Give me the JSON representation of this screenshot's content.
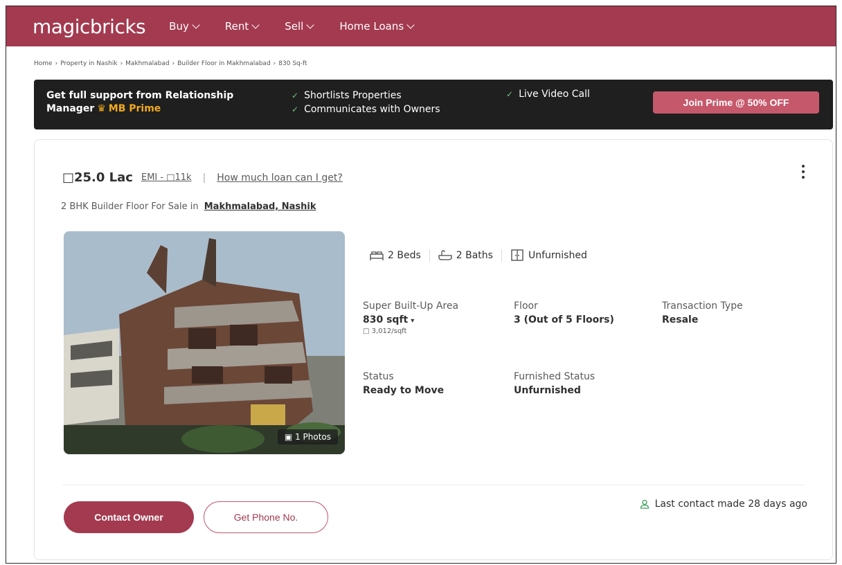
{
  "brand": {
    "logo": "magicbricks",
    "accent": "#a33a50"
  },
  "nav": [
    {
      "label": "Buy"
    },
    {
      "label": "Rent"
    },
    {
      "label": "Sell"
    },
    {
      "label": "Home Loans"
    }
  ],
  "breadcrumb": [
    "Home",
    "Property in Nashik",
    "Makhmalabad",
    "Builder Floor in Makhmalabad",
    "830 Sq-ft"
  ],
  "prime_bar": {
    "line1": "Get full support from Relationship",
    "line2_prefix": "Manager",
    "crown_glyph": "♛",
    "mb_prime": "MB Prime",
    "features": [
      "Shortlists Properties",
      "Communicates with Owners",
      "Live Video Call"
    ],
    "tick": "✓",
    "join_label": "Join Prime @ 50% OFF"
  },
  "listing": {
    "price": "□25.0 Lac",
    "emi": "EMI - □11k",
    "loan_link": "How much loan can I get?",
    "title_prefix": "2 BHK Builder Floor For Sale in",
    "location": "Makhmalabad, Nashik",
    "photo_count": "1 Photos",
    "photo_icon": "▣",
    "amenities": [
      {
        "icon": "bed-icon",
        "label": "2 Beds"
      },
      {
        "icon": "bath-icon",
        "label": "2 Baths"
      },
      {
        "icon": "wardrobe-icon",
        "label": "Unfurnished"
      }
    ],
    "specs": {
      "area_label": "Super Built-Up Area",
      "area_value": "830 sqft",
      "area_caret": "▾",
      "area_rate": "□ 3,012/sqft",
      "floor_label": "Floor",
      "floor_value": "3 (Out of 5 Floors)",
      "transaction_label": "Transaction Type",
      "transaction_value": "Resale",
      "status_label": "Status",
      "status_value": "Ready to Move",
      "furnished_label": "Furnished Status",
      "furnished_value": "Unfurnished"
    },
    "contact_owner": "Contact Owner",
    "get_phone": "Get Phone No.",
    "last_contact": "Last contact made 28 days ago"
  }
}
